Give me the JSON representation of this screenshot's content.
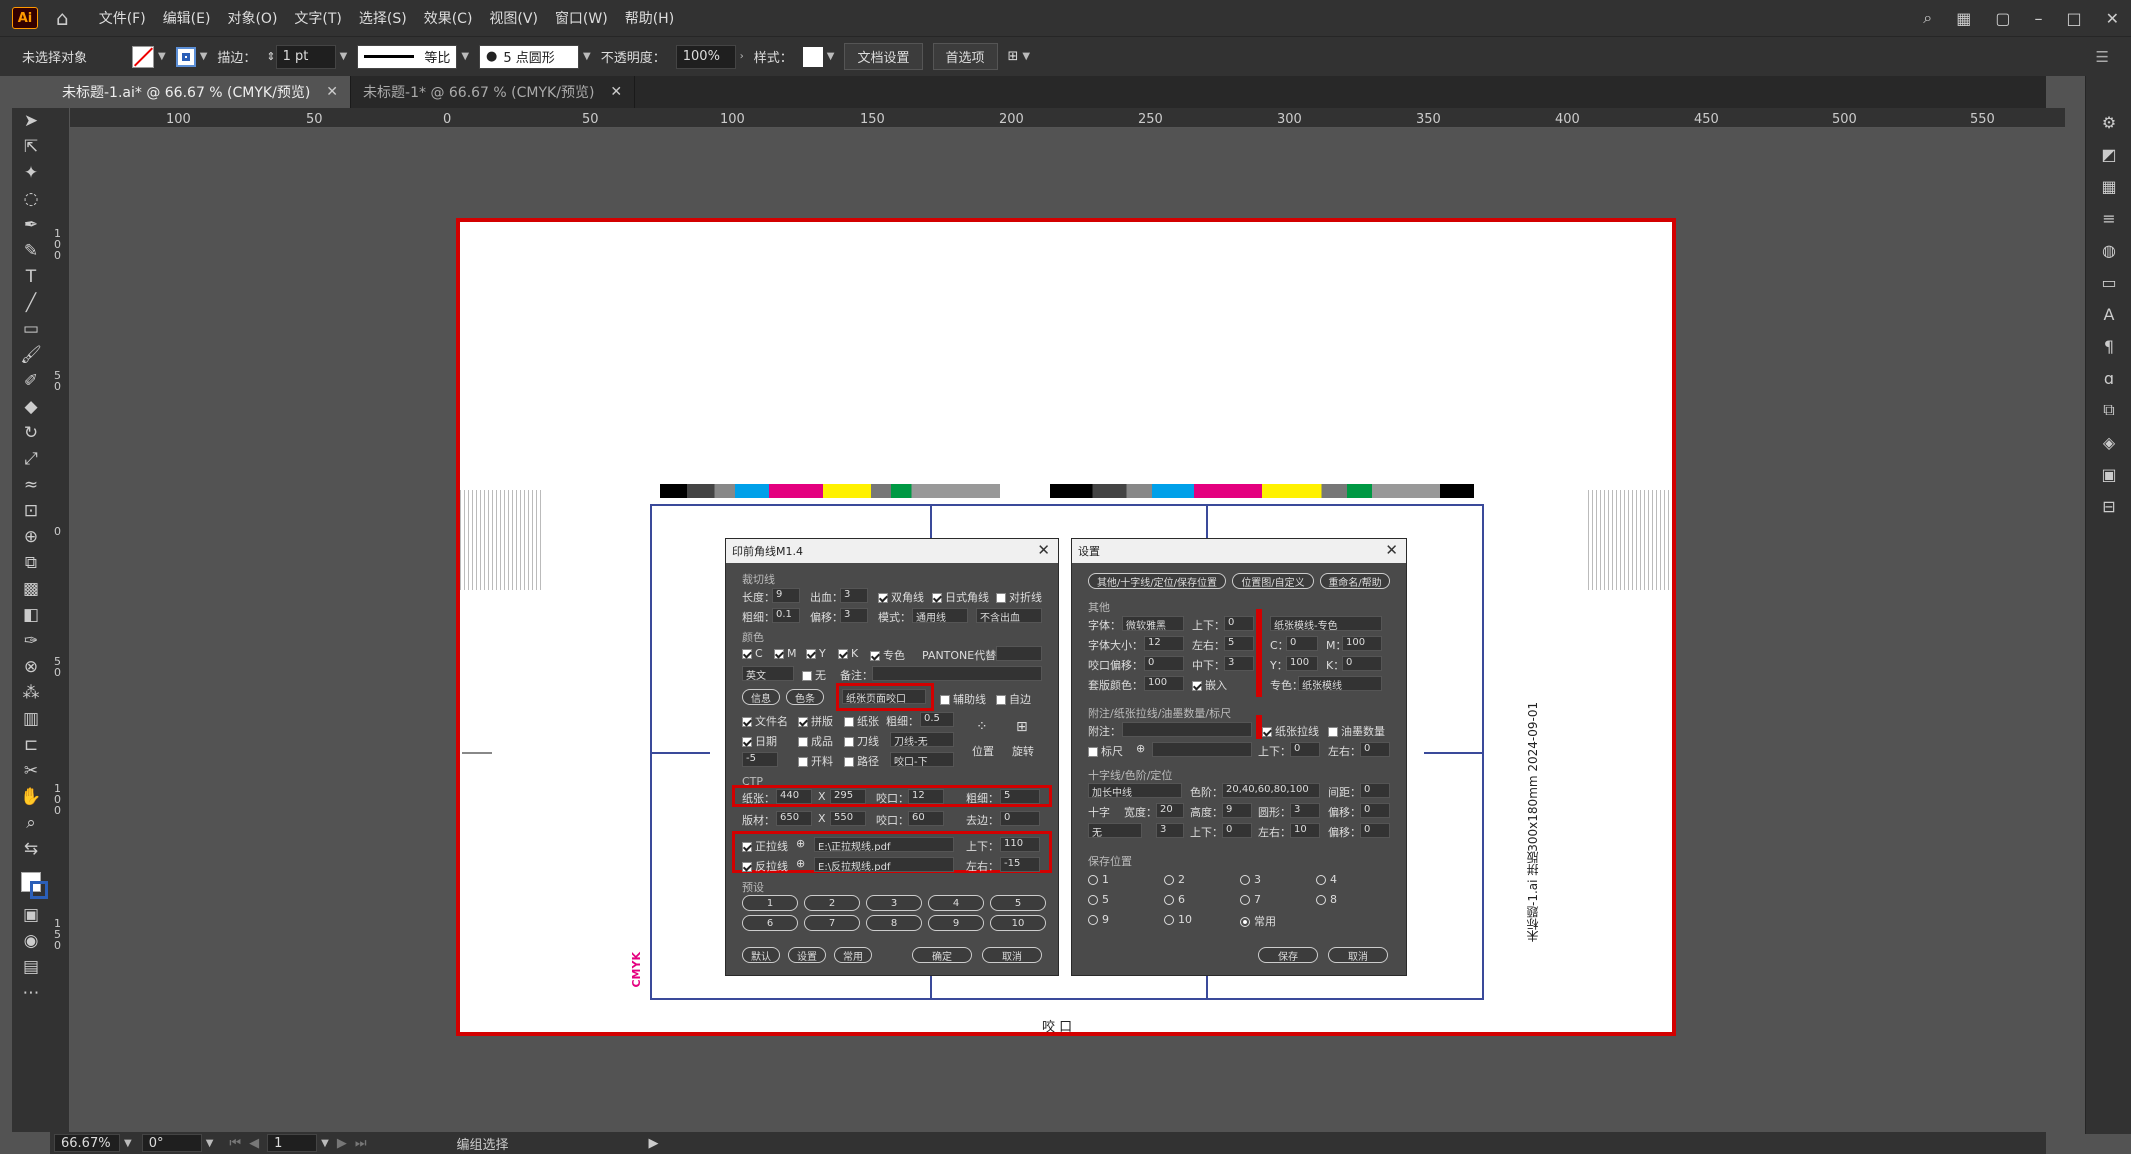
{
  "app": {
    "logo": "Ai",
    "menus": [
      "文件(F)",
      "编辑(E)",
      "对象(O)",
      "文字(T)",
      "选择(S)",
      "效果(C)",
      "视图(V)",
      "窗口(W)",
      "帮助(H)"
    ]
  },
  "control": {
    "selection": "未选择对象",
    "stroke_label": "描边：",
    "stroke_value": "1 pt",
    "stroke_profile": "等比",
    "brush": "5 点圆形",
    "opacity_label": "不透明度：",
    "opacity_value": "100%",
    "style_label": "样式：",
    "doc_setup": "文档设置",
    "prefs": "首选项"
  },
  "tabs": [
    {
      "label": "未标题-1.ai* @ 66.67 % (CMYK/预览)"
    },
    {
      "label": "未标题-1* @ 66.67 % (CMYK/预览)"
    }
  ],
  "ruler": {
    "h": [
      "100",
      "50",
      "0",
      "50",
      "100",
      "150",
      "200",
      "250",
      "300",
      "350",
      "400",
      "450",
      "500",
      "550"
    ],
    "v": [
      "100",
      "50",
      "0",
      "50",
      "100",
      "150"
    ]
  },
  "status": {
    "zoom": "66.67%",
    "angle": "0°",
    "page": "1",
    "mode": "编组选择"
  },
  "artboard": {
    "side_text": "未标题-1.ai  拼版300x180mm  2024-09-01",
    "bottom_text": "咬  口",
    "cmyk": "CMYK"
  },
  "dlg1": {
    "title": "印前角线M1.4",
    "s1": "裁切线",
    "len": "长度：",
    "len_v": "9",
    "bleed": "出血：",
    "bleed_v": "3",
    "dbl": "双角线",
    "jp": "日式角线",
    "fold": "对折线",
    "thick": "粗细：",
    "thick_v": "0.1",
    "off": "偏移：",
    "off_v": "3",
    "mode": "模式：",
    "mode_v": "通用线",
    "nobleed": "不含出血",
    "s2": "颜色",
    "c": "C",
    "m": "M",
    "y": "Y",
    "k": "K",
    "spot": "专色",
    "pantone": "PANTONE代替：",
    "lang": "英文",
    "none": "无",
    "note": "备注：",
    "info": "信息",
    "color": "色条",
    "paper_edge": "纸张页面咬口",
    "guide": "辅助线",
    "self": "自边",
    "fname": "文件名",
    "impose": "拼版",
    "paper": "纸张",
    "thick2": "粗细：",
    "thick2_v": "0.5",
    "pos": "位置",
    "rot": "旋转",
    "date": "日期",
    "finish": "成品",
    "knife": "刀线",
    "knife_v": "刀线-无",
    "n5": "-5",
    "open": "开料",
    "path": "路径",
    "bite_down": "咬口-下",
    "s3": "CTP",
    "paper_w": "纸张：",
    "paper_w_v": "440",
    "x1": "X",
    "paper_h_v": "295",
    "bite": "咬口：",
    "bite_v": "12",
    "th3": "粗细：",
    "th3_v": "5",
    "plate": "版材：",
    "plate_w_v": "650",
    "x2": "X",
    "plate_h_v": "550",
    "bite2": "咬口：",
    "bite2_v": "60",
    "drop": "去边：",
    "drop_v": "0",
    "pos_line": "正拉线",
    "pos_path": "E:\\正拉规线.pdf",
    "ud": "上下：",
    "ud_v": "110",
    "neg_line": "反拉线",
    "neg_path": "E:\\反拉规线.pdf",
    "lr": "左右：",
    "lr_v": "-15",
    "s4": "预设",
    "presets": [
      "1",
      "2",
      "3",
      "4",
      "5",
      "6",
      "7",
      "8",
      "9",
      "10"
    ],
    "default": "默认",
    "setup": "设置",
    "common": "常用",
    "ok": "确定",
    "cancel": "取消"
  },
  "dlg2": {
    "title": "设置",
    "tab1": "其他/十字线/定位/保存位置",
    "tab2": "位置图/自定义",
    "tab3": "重命名/帮助",
    "s1": "其他",
    "font": "字体：",
    "font_v": "微软雅黑",
    "ud": "上下：",
    "ud_v": "0",
    "size": "字体大小：",
    "size_v": "12",
    "lr": "左右：",
    "lr_v": "5",
    "biteoff": "咬口偏移：",
    "biteoff_v": "0",
    "mid": "中下：",
    "mid_v": "3",
    "regc": "套版颜色：",
    "regc_v": "100",
    "embed": "嵌入",
    "paper_mode": "纸张模线-专色",
    "cl": "C：",
    "cv": "0",
    "ml": "M：",
    "mv": "100",
    "yl": "Y：",
    "yv": "100",
    "kl": "K：",
    "kv": "0",
    "spot": "专色：",
    "spot_v": "纸张模线",
    "s2": "附注/纸张拉线/油墨数量/标尺",
    "note": "附注：",
    "paper_pull": "纸张拉线",
    "ink": "油墨数量",
    "ruler": "标尺",
    "ud2": "上下：",
    "ud2_v": "0",
    "lr2": "左右：",
    "lr2_v": "0",
    "s3": "十字线/色阶/定位",
    "cross_mode": "加长中线",
    "levels": "色阶：",
    "levels_v": "20,40,60,80,100",
    "gap": "间距：",
    "gap_v": "0",
    "cross": "十字",
    "width": "宽度：",
    "width_v": "20",
    "height": "高度：",
    "height_v": "9",
    "shape": "圆形：",
    "shape_v": "3",
    "off": "偏移：",
    "off_v": "0",
    "none": "无",
    "n3": "3",
    "ud3": "上下：",
    "ud3_v": "0",
    "lr3": "左右：",
    "lr3_v": "10",
    "off2": "偏移：",
    "off2_v": "0",
    "s4": "保存位置",
    "slots": [
      "1",
      "2",
      "3",
      "4",
      "5",
      "6",
      "7",
      "8",
      "9",
      "10"
    ],
    "common": "常用",
    "save": "保存",
    "cancel": "取消"
  },
  "colors": {
    "accent": "#d30000",
    "panel": "#323232",
    "canvas": "#535353"
  }
}
